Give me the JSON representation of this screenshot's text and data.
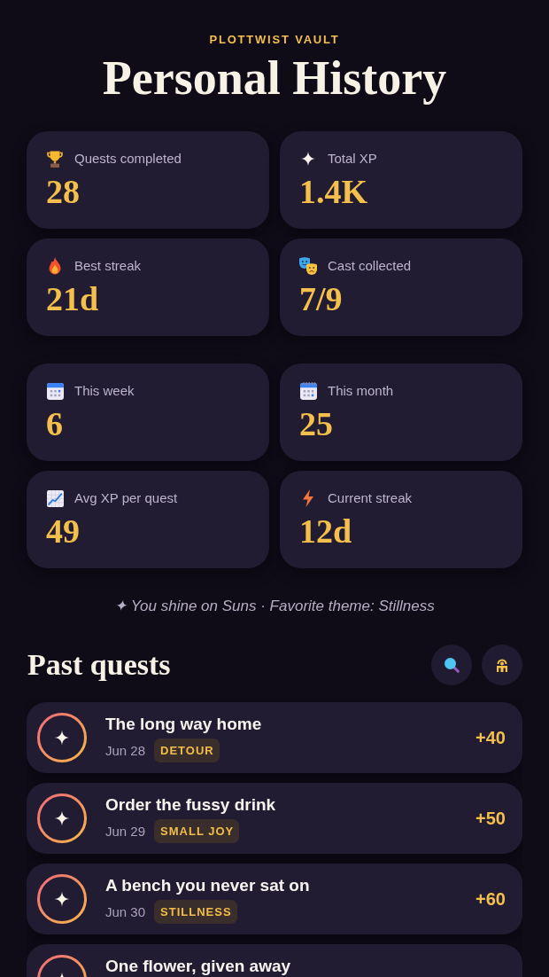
{
  "header": {
    "eyebrow": "PLOTTWIST VAULT",
    "title": "Personal History"
  },
  "stat_groups": [
    {
      "stats": [
        {
          "kind": "trophy",
          "label": "Quests completed",
          "value": "28"
        },
        {
          "kind": "sparkle",
          "label": "Total XP",
          "value": "1.4K"
        },
        {
          "kind": "fire",
          "label": "Best streak",
          "value": "21d"
        },
        {
          "kind": "masks",
          "label": "Cast collected",
          "value": "7/9"
        }
      ]
    },
    {
      "stats": [
        {
          "kind": "calendar",
          "label": "This week",
          "value": "6"
        },
        {
          "kind": "spiralcalendar",
          "label": "This month",
          "value": "25"
        },
        {
          "kind": "chart",
          "label": "Avg XP per quest",
          "value": "49"
        },
        {
          "kind": "bolt",
          "label": "Current streak",
          "value": "12d"
        }
      ]
    }
  ],
  "summary": "✦ You shine on Suns · Favorite theme: Stillness",
  "past_quests": {
    "title": "Past quests",
    "actions": [
      {
        "kind": "search"
      },
      {
        "kind": "figure"
      }
    ],
    "quests": [
      {
        "title": "The long way home",
        "date": "Jun 28",
        "tag": "DETOUR",
        "xp": "+40"
      },
      {
        "title": "Order the fussy drink",
        "date": "Jun 29",
        "tag": "SMALL JOY",
        "xp": "+50"
      },
      {
        "title": "A bench you never sat on",
        "date": "Jun 30",
        "tag": "STILLNESS",
        "xp": "+60"
      },
      {
        "title": "One flower, given away"
      }
    ]
  }
}
